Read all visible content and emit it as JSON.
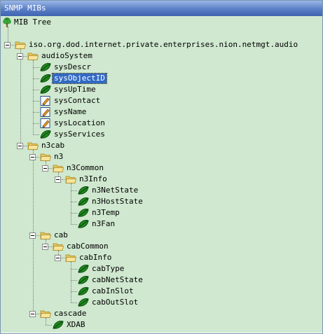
{
  "window": {
    "title": "SNMP MIBs"
  },
  "tree": {
    "root_label": "MIB Tree",
    "nodes": [
      {
        "label": "iso.org.dod.internet.private.enterprises.nion.netmgt.audio",
        "type": "folder",
        "expanded": true
      },
      {
        "label": "audioSystem",
        "type": "folder",
        "expanded": true
      },
      {
        "label": "sysDescr",
        "type": "leaf"
      },
      {
        "label": "sysObjectID",
        "type": "leaf",
        "selected": true
      },
      {
        "label": "sysUpTime",
        "type": "leaf"
      },
      {
        "label": "sysContact",
        "type": "writable"
      },
      {
        "label": "sysName",
        "type": "writable"
      },
      {
        "label": "sysLocation",
        "type": "writable"
      },
      {
        "label": "sysServices",
        "type": "leaf"
      },
      {
        "label": "n3cab",
        "type": "folder",
        "expanded": true
      },
      {
        "label": "n3",
        "type": "folder",
        "expanded": true
      },
      {
        "label": "n3Common",
        "type": "folder",
        "expanded": true
      },
      {
        "label": "n3Info",
        "type": "folder",
        "expanded": true
      },
      {
        "label": "n3NetState",
        "type": "leaf"
      },
      {
        "label": "n3HostState",
        "type": "leaf"
      },
      {
        "label": "n3Temp",
        "type": "leaf"
      },
      {
        "label": "n3Fan",
        "type": "leaf"
      },
      {
        "label": "cab",
        "type": "folder",
        "expanded": true
      },
      {
        "label": "cabCommon",
        "type": "folder",
        "expanded": true
      },
      {
        "label": "cabInfo",
        "type": "folder",
        "expanded": true
      },
      {
        "label": "cabType",
        "type": "leaf"
      },
      {
        "label": "cabNetState",
        "type": "leaf"
      },
      {
        "label": "cabInSlot",
        "type": "leaf"
      },
      {
        "label": "cabOutSlot",
        "type": "leaf"
      },
      {
        "label": "cascade",
        "type": "folder",
        "expanded": true
      },
      {
        "label": "XDAB",
        "type": "leaf"
      }
    ]
  },
  "icons": {
    "root": "tree-icon",
    "folder": "folder-open-icon",
    "leaf": "leaf-icon",
    "writable": "pencil-doc-icon"
  },
  "colors": {
    "tree_background": "#cfe8cf",
    "selection": "#316ac5",
    "title_bar": "#5a7fc6"
  }
}
